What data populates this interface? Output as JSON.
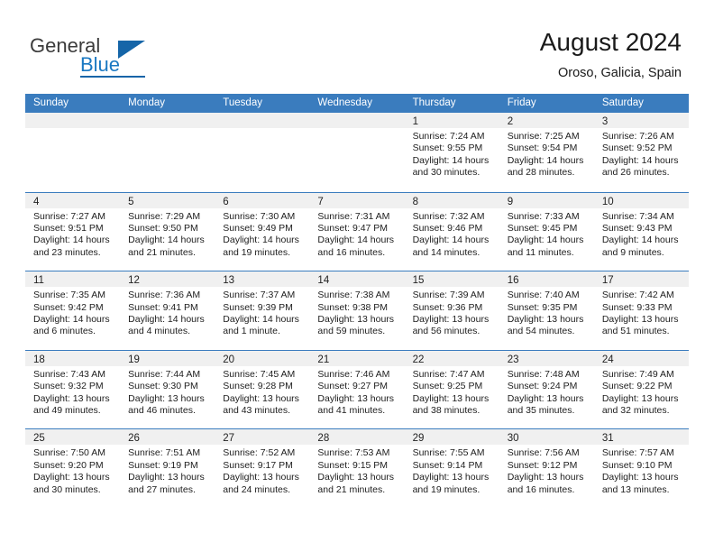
{
  "brand": {
    "name_part1": "General",
    "name_part2": "Blue",
    "logo_icon": "triangle-logo-icon"
  },
  "header": {
    "title": "August 2024",
    "subtitle": "Oroso, Galicia, Spain"
  },
  "calendar": {
    "day_headers": [
      "Sunday",
      "Monday",
      "Tuesday",
      "Wednesday",
      "Thursday",
      "Friday",
      "Saturday"
    ],
    "colors": {
      "header_band": "#3a7cbe",
      "daynum_band": "#f0f0f0",
      "row_separator": "#3a7cbe",
      "brand_blue": "#1a78c2"
    },
    "weeks": [
      [
        {
          "empty": true
        },
        {
          "empty": true
        },
        {
          "empty": true
        },
        {
          "empty": true
        },
        {
          "day": "1",
          "sunrise": "Sunrise: 7:24 AM",
          "sunset": "Sunset: 9:55 PM",
          "daylight": "Daylight: 14 hours and 30 minutes."
        },
        {
          "day": "2",
          "sunrise": "Sunrise: 7:25 AM",
          "sunset": "Sunset: 9:54 PM",
          "daylight": "Daylight: 14 hours and 28 minutes."
        },
        {
          "day": "3",
          "sunrise": "Sunrise: 7:26 AM",
          "sunset": "Sunset: 9:52 PM",
          "daylight": "Daylight: 14 hours and 26 minutes."
        }
      ],
      [
        {
          "day": "4",
          "sunrise": "Sunrise: 7:27 AM",
          "sunset": "Sunset: 9:51 PM",
          "daylight": "Daylight: 14 hours and 23 minutes."
        },
        {
          "day": "5",
          "sunrise": "Sunrise: 7:29 AM",
          "sunset": "Sunset: 9:50 PM",
          "daylight": "Daylight: 14 hours and 21 minutes."
        },
        {
          "day": "6",
          "sunrise": "Sunrise: 7:30 AM",
          "sunset": "Sunset: 9:49 PM",
          "daylight": "Daylight: 14 hours and 19 minutes."
        },
        {
          "day": "7",
          "sunrise": "Sunrise: 7:31 AM",
          "sunset": "Sunset: 9:47 PM",
          "daylight": "Daylight: 14 hours and 16 minutes."
        },
        {
          "day": "8",
          "sunrise": "Sunrise: 7:32 AM",
          "sunset": "Sunset: 9:46 PM",
          "daylight": "Daylight: 14 hours and 14 minutes."
        },
        {
          "day": "9",
          "sunrise": "Sunrise: 7:33 AM",
          "sunset": "Sunset: 9:45 PM",
          "daylight": "Daylight: 14 hours and 11 minutes."
        },
        {
          "day": "10",
          "sunrise": "Sunrise: 7:34 AM",
          "sunset": "Sunset: 9:43 PM",
          "daylight": "Daylight: 14 hours and 9 minutes."
        }
      ],
      [
        {
          "day": "11",
          "sunrise": "Sunrise: 7:35 AM",
          "sunset": "Sunset: 9:42 PM",
          "daylight": "Daylight: 14 hours and 6 minutes."
        },
        {
          "day": "12",
          "sunrise": "Sunrise: 7:36 AM",
          "sunset": "Sunset: 9:41 PM",
          "daylight": "Daylight: 14 hours and 4 minutes."
        },
        {
          "day": "13",
          "sunrise": "Sunrise: 7:37 AM",
          "sunset": "Sunset: 9:39 PM",
          "daylight": "Daylight: 14 hours and 1 minute."
        },
        {
          "day": "14",
          "sunrise": "Sunrise: 7:38 AM",
          "sunset": "Sunset: 9:38 PM",
          "daylight": "Daylight: 13 hours and 59 minutes."
        },
        {
          "day": "15",
          "sunrise": "Sunrise: 7:39 AM",
          "sunset": "Sunset: 9:36 PM",
          "daylight": "Daylight: 13 hours and 56 minutes."
        },
        {
          "day": "16",
          "sunrise": "Sunrise: 7:40 AM",
          "sunset": "Sunset: 9:35 PM",
          "daylight": "Daylight: 13 hours and 54 minutes."
        },
        {
          "day": "17",
          "sunrise": "Sunrise: 7:42 AM",
          "sunset": "Sunset: 9:33 PM",
          "daylight": "Daylight: 13 hours and 51 minutes."
        }
      ],
      [
        {
          "day": "18",
          "sunrise": "Sunrise: 7:43 AM",
          "sunset": "Sunset: 9:32 PM",
          "daylight": "Daylight: 13 hours and 49 minutes."
        },
        {
          "day": "19",
          "sunrise": "Sunrise: 7:44 AM",
          "sunset": "Sunset: 9:30 PM",
          "daylight": "Daylight: 13 hours and 46 minutes."
        },
        {
          "day": "20",
          "sunrise": "Sunrise: 7:45 AM",
          "sunset": "Sunset: 9:28 PM",
          "daylight": "Daylight: 13 hours and 43 minutes."
        },
        {
          "day": "21",
          "sunrise": "Sunrise: 7:46 AM",
          "sunset": "Sunset: 9:27 PM",
          "daylight": "Daylight: 13 hours and 41 minutes."
        },
        {
          "day": "22",
          "sunrise": "Sunrise: 7:47 AM",
          "sunset": "Sunset: 9:25 PM",
          "daylight": "Daylight: 13 hours and 38 minutes."
        },
        {
          "day": "23",
          "sunrise": "Sunrise: 7:48 AM",
          "sunset": "Sunset: 9:24 PM",
          "daylight": "Daylight: 13 hours and 35 minutes."
        },
        {
          "day": "24",
          "sunrise": "Sunrise: 7:49 AM",
          "sunset": "Sunset: 9:22 PM",
          "daylight": "Daylight: 13 hours and 32 minutes."
        }
      ],
      [
        {
          "day": "25",
          "sunrise": "Sunrise: 7:50 AM",
          "sunset": "Sunset: 9:20 PM",
          "daylight": "Daylight: 13 hours and 30 minutes."
        },
        {
          "day": "26",
          "sunrise": "Sunrise: 7:51 AM",
          "sunset": "Sunset: 9:19 PM",
          "daylight": "Daylight: 13 hours and 27 minutes."
        },
        {
          "day": "27",
          "sunrise": "Sunrise: 7:52 AM",
          "sunset": "Sunset: 9:17 PM",
          "daylight": "Daylight: 13 hours and 24 minutes."
        },
        {
          "day": "28",
          "sunrise": "Sunrise: 7:53 AM",
          "sunset": "Sunset: 9:15 PM",
          "daylight": "Daylight: 13 hours and 21 minutes."
        },
        {
          "day": "29",
          "sunrise": "Sunrise: 7:55 AM",
          "sunset": "Sunset: 9:14 PM",
          "daylight": "Daylight: 13 hours and 19 minutes."
        },
        {
          "day": "30",
          "sunrise": "Sunrise: 7:56 AM",
          "sunset": "Sunset: 9:12 PM",
          "daylight": "Daylight: 13 hours and 16 minutes."
        },
        {
          "day": "31",
          "sunrise": "Sunrise: 7:57 AM",
          "sunset": "Sunset: 9:10 PM",
          "daylight": "Daylight: 13 hours and 13 minutes."
        }
      ]
    ]
  }
}
